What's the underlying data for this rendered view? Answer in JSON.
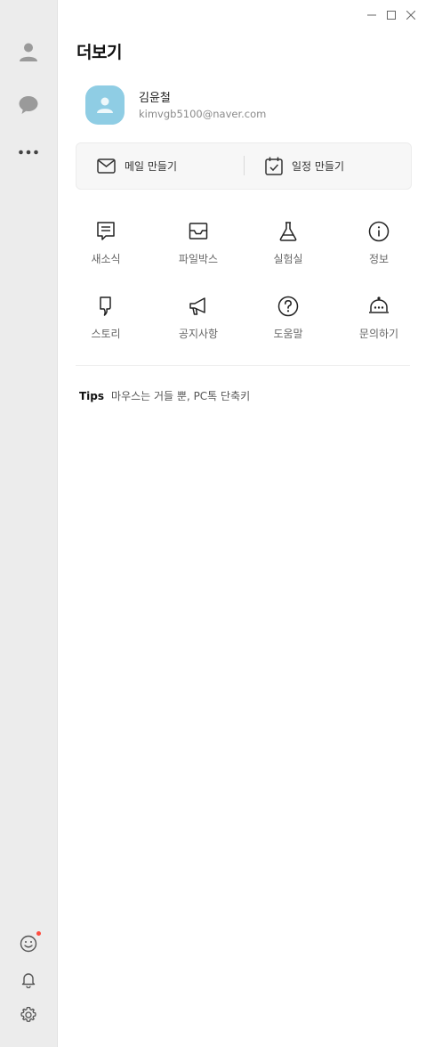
{
  "window": {
    "controls": [
      "minimize-icon",
      "maximize-icon",
      "close-icon"
    ]
  },
  "sidebar": {
    "top_items": [
      {
        "name": "friends",
        "icon": "person-icon"
      },
      {
        "name": "chats",
        "icon": "chat-bubble-icon"
      },
      {
        "name": "more",
        "icon": "more-dots-icon",
        "active": true
      }
    ],
    "bottom_items": [
      {
        "name": "emoticon",
        "icon": "smile-icon",
        "badge": true
      },
      {
        "name": "notifications",
        "icon": "bell-icon"
      },
      {
        "name": "settings",
        "icon": "gear-icon"
      }
    ]
  },
  "page": {
    "title": "더보기"
  },
  "profile": {
    "name": "김윤철",
    "email": "kimvgb5100@naver.com",
    "avatar_color": "#8fcde4"
  },
  "quick_actions": {
    "mail": {
      "label": "메일 만들기",
      "icon": "mail-icon"
    },
    "calendar": {
      "label": "일정 만들기",
      "icon": "calendar-check-icon"
    }
  },
  "grid": {
    "news": {
      "label": "새소식",
      "icon": "news-icon"
    },
    "filebox": {
      "label": "파일박스",
      "icon": "inbox-tray-icon"
    },
    "lab": {
      "label": "실험실",
      "icon": "flask-icon"
    },
    "info": {
      "label": "정보",
      "icon": "info-icon"
    },
    "story": {
      "label": "스토리",
      "icon": "story-icon"
    },
    "notice": {
      "label": "공지사항",
      "icon": "megaphone-icon"
    },
    "help": {
      "label": "도움말",
      "icon": "question-icon"
    },
    "inquiry": {
      "label": "문의하기",
      "icon": "bell-desk-icon"
    }
  },
  "tips": {
    "label": "Tips",
    "text": "마우스는 거들 뿐, PC톡 단축키"
  }
}
